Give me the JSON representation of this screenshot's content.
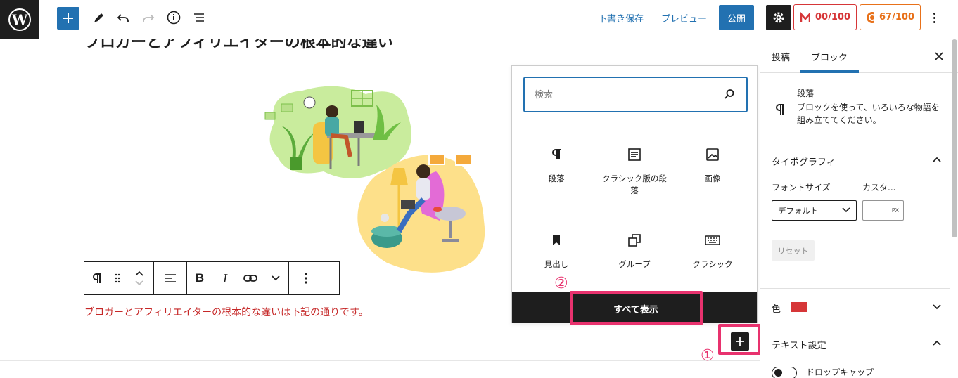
{
  "topbar": {
    "save_draft": "下書き保存",
    "preview": "プレビュー",
    "publish": "公開",
    "score_red": "00/100",
    "score_orange": "67/100"
  },
  "editor": {
    "heading": "ブロガーとアフィリエイターの根本的な違い",
    "paragraph": "ブロガーとアフィリエイターの根本的な違いは下記の通りです。"
  },
  "inserter": {
    "search_placeholder": "検索",
    "blocks": [
      {
        "label": "段落",
        "icon": "paragraph-icon"
      },
      {
        "label": "クラシック版の段落",
        "icon": "classic-paragraph-icon"
      },
      {
        "label": "画像",
        "icon": "image-icon"
      },
      {
        "label": "見出し",
        "icon": "heading-bookmark-icon"
      },
      {
        "label": "グループ",
        "icon": "group-icon"
      },
      {
        "label": "クラシック",
        "icon": "keyboard-icon"
      }
    ],
    "show_all": "すべて表示"
  },
  "annotations": {
    "marker1": "①",
    "marker2": "②",
    "color": "#e8326e"
  },
  "sidebar": {
    "tabs": [
      "投稿",
      "ブロック"
    ],
    "active_tab": "ブロック",
    "block_name": "段落",
    "block_desc": "ブロックを使って、いろいろな物語を組み立ててください。",
    "typography": "タイポグラフィ",
    "font_size_label": "フォントサイズ",
    "custom_label": "カスタ...",
    "font_size_value": "デフォルト",
    "unit": "PX",
    "reset": "リセット",
    "color_label": "色",
    "color_swatch": "#d63638",
    "text_settings": "テキスト設定",
    "drop_cap": "ドロップキャップ"
  },
  "colors": {
    "accent": "#2271b1",
    "paragraph_text": "#c62828"
  }
}
